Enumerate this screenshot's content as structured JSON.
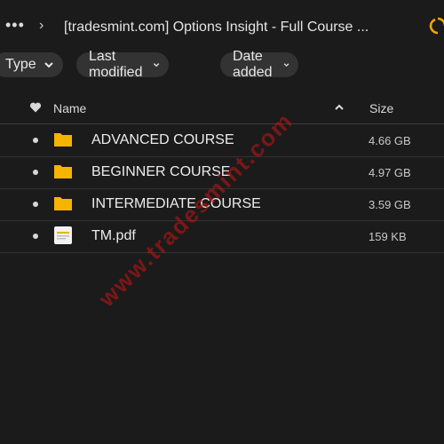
{
  "toolbar": {
    "more_label": "•••",
    "breadcrumb_separator": "›",
    "breadcrumb_title": "[tradesmint.com] Options Insight - Full Course ..."
  },
  "filters": [
    {
      "label": "Type"
    },
    {
      "label": "Last modified"
    },
    {
      "label": "Date added"
    }
  ],
  "table": {
    "columns": {
      "name": "Name",
      "size": "Size"
    },
    "rows": [
      {
        "icon": "folder-icon",
        "name": "ADVANCED COURSE",
        "size": "4.66 GB"
      },
      {
        "icon": "folder-icon",
        "name": "BEGINNER COURSE",
        "size": "4.97 GB"
      },
      {
        "icon": "folder-icon",
        "name": "INTERMEDIATE COURSE",
        "size": "3.59 GB"
      },
      {
        "icon": "pdf-file-icon",
        "name": "TM.pdf",
        "size": "159 KB"
      }
    ]
  },
  "watermark": "www.tradesmint.com",
  "colors": {
    "background": "#1b1b1b",
    "chip": "#333333",
    "folder": "#f5b400",
    "sync": "#f5a300",
    "watermark": "#c81414"
  }
}
